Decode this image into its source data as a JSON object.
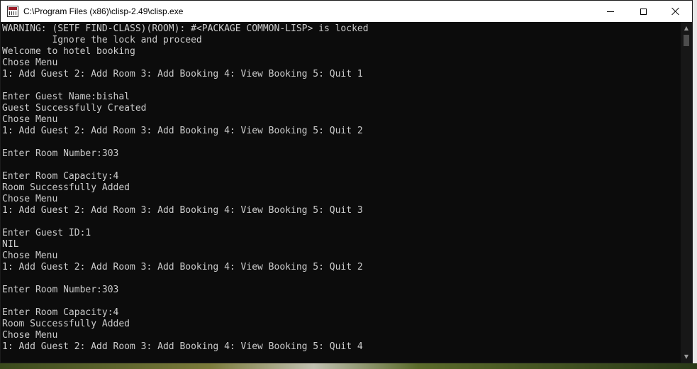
{
  "window": {
    "title": "C:\\Program Files (x86)\\clisp-2.49\\clisp.exe",
    "controls": {
      "minimize_icon": "minimize-icon",
      "maximize_icon": "maximize-icon",
      "close_icon": "close-icon"
    }
  },
  "console": {
    "lines": [
      "WARNING: (SETF FIND-CLASS)(ROOM): #<PACKAGE COMMON-LISP> is locked",
      "         Ignore the lock and proceed",
      "Welcome to hotel booking",
      "Chose Menu",
      "1: Add Guest 2: Add Room 3: Add Booking 4: View Booking 5: Quit 1",
      "",
      "Enter Guest Name:bishal",
      "Guest Successfully Created",
      "Chose Menu",
      "1: Add Guest 2: Add Room 3: Add Booking 4: View Booking 5: Quit 2",
      "",
      "Enter Room Number:303",
      "",
      "Enter Room Capacity:4",
      "Room Successfully Added",
      "Chose Menu",
      "1: Add Guest 2: Add Room 3: Add Booking 4: View Booking 5: Quit 3",
      "",
      "Enter Guest ID:1",
      "NIL",
      "Chose Menu",
      "1: Add Guest 2: Add Room 3: Add Booking 4: View Booking 5: Quit 2",
      "",
      "Enter Room Number:303",
      "",
      "Enter Room Capacity:4",
      "Room Successfully Added",
      "Chose Menu",
      "1: Add Guest 2: Add Room 3: Add Booking 4: View Booking 5: Quit 4"
    ]
  },
  "colors": {
    "console_background": "#0c0c0c",
    "console_text": "#cccccc",
    "titlebar": "#ffffff"
  }
}
